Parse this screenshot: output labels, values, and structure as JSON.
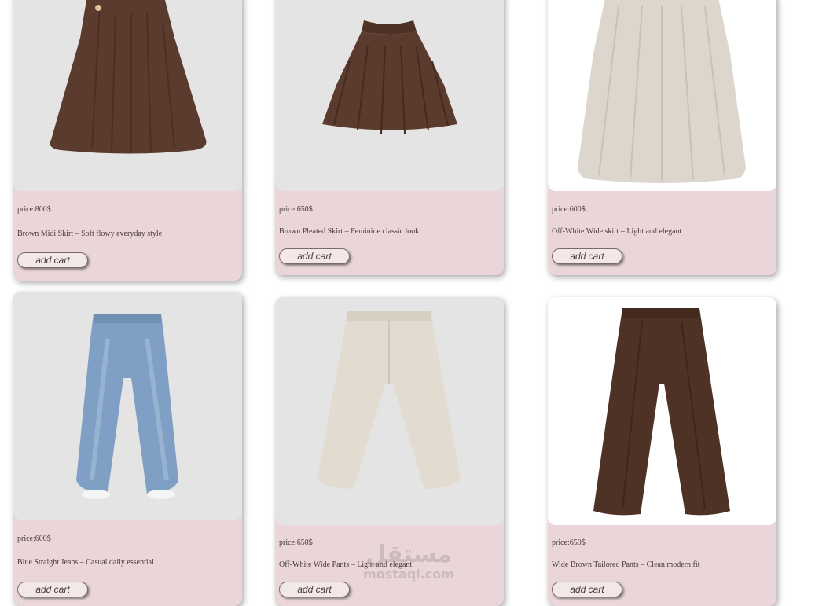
{
  "products": [
    {
      "price": "price:800$",
      "description": "Brown Midi Skirt – Soft flowy everyday style",
      "button": "add cart",
      "image": "brown-midi-skirt"
    },
    {
      "price": "price:650$",
      "description": "Brown Pleated Skirt – Feminine classic look",
      "button": "add cart",
      "image": "brown-pleated-skirt"
    },
    {
      "price": "price:600$",
      "description": "Off-White Wide skirt – Light and elegant",
      "button": "add cart",
      "image": "off-white-wide-skirt"
    },
    {
      "price": "price:600$",
      "description": "Blue Straight Jeans – Casual daily essential",
      "button": "add cart",
      "image": "blue-straight-jeans"
    },
    {
      "price": "price:650$",
      "description": "Off-White Wide Pants – Light and elegant",
      "button": "add cart",
      "image": "off-white-wide-pants"
    },
    {
      "price": "price:650$",
      "description": "Wide Brown Tailored Pants – Clean modern fit",
      "button": "add cart",
      "image": "wide-brown-tailored-pants"
    }
  ],
  "watermark": {
    "arabic": "مستقل",
    "latin": "mostaql.com"
  },
  "colors": {
    "card": "#ead6d8",
    "photo_bg": "#e4e4e4",
    "brown": "#5b3b2e",
    "denim": "#7f9fc4",
    "cream": "#e2dbd0"
  }
}
